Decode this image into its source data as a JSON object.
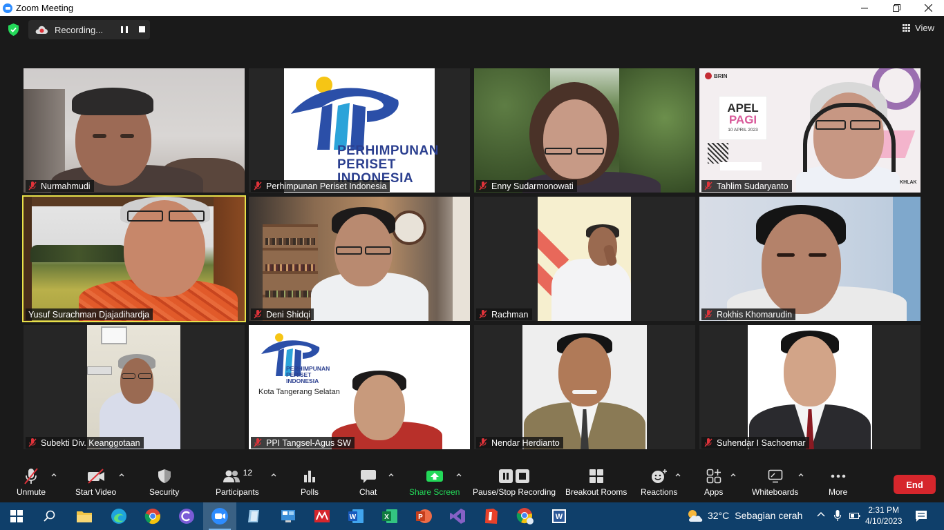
{
  "window": {
    "title": "Zoom Meeting",
    "minimize": "—",
    "maximize": "❐",
    "close": "✕"
  },
  "topbar": {
    "recording_label": "Recording...",
    "view_label": "View"
  },
  "participants": [
    {
      "name": "Nurmahmudi"
    },
    {
      "name": "Perhimpunan Periset Indonesia",
      "logo_text": [
        "PERHIMPUNAN",
        "PERISET",
        "INDONESIA"
      ]
    },
    {
      "name": "Enny Sudarmonowati"
    },
    {
      "name": "Tahlim Sudaryanto",
      "banner_brand": "BRIN",
      "banner_title_1": "APEL",
      "banner_title_2": "PAGI",
      "banner_date": "10 APRIL 2023",
      "banner_tag": "AKHLAK"
    },
    {
      "name": "Yusuf Surachman Djajadihardja"
    },
    {
      "name": "Deni Shidqi"
    },
    {
      "name": "Rachman"
    },
    {
      "name": "Rokhis Khomarudin"
    },
    {
      "name": "Subekti Div. Keanggotaan"
    },
    {
      "name": "PPI Tangsel-Agus SW",
      "logo_text": [
        "PERHIMPUNAN",
        "PERISET",
        "INDONESIA"
      ],
      "city_text": "Kota Tangerang Selatan"
    },
    {
      "name": "Nendar Herdianto"
    },
    {
      "name": "Suhendar I Sachoemar"
    }
  ],
  "toolbar": {
    "unmute": "Unmute",
    "start_video": "Start Video",
    "security": "Security",
    "participants": "Participants",
    "participants_count": "12",
    "polls": "Polls",
    "chat": "Chat",
    "share_screen": "Share Screen",
    "pause_stop_recording": "Pause/Stop Recording",
    "breakout_rooms": "Breakout Rooms",
    "reactions": "Reactions",
    "apps": "Apps",
    "whiteboards": "Whiteboards",
    "more": "More",
    "end": "End"
  },
  "taskbar": {
    "temperature": "32°C",
    "weather": "Sebagian cerah",
    "time": "2:31 PM",
    "date": "4/10/2023"
  },
  "colors": {
    "accent_share": "#23d959",
    "end_red": "#d6262c",
    "active_speaker": "#e8e14a",
    "muted_red": "#e0333a"
  }
}
